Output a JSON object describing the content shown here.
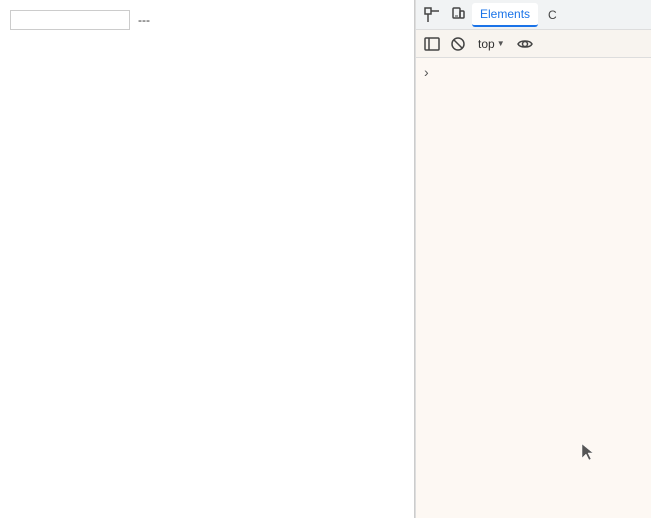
{
  "left_panel": {
    "input_value": "",
    "input_placeholder": "",
    "dash_label": "---"
  },
  "devtools": {
    "tabs": [
      {
        "id": "elements",
        "label": "Elements",
        "active": true
      },
      {
        "id": "console",
        "label": "C",
        "active": false
      }
    ],
    "toolbar": {
      "sidebar_toggle_title": "Toggle sidebar",
      "block_toggle_title": "Toggle block mode",
      "top_dropdown_label": "top",
      "eye_title": "Toggle eye",
      "icons": {
        "sidebar": "⊞",
        "block": "⊟",
        "eye": "👁",
        "dropdown_arrow": "▼"
      }
    },
    "content": {
      "chevron": "›"
    }
  }
}
